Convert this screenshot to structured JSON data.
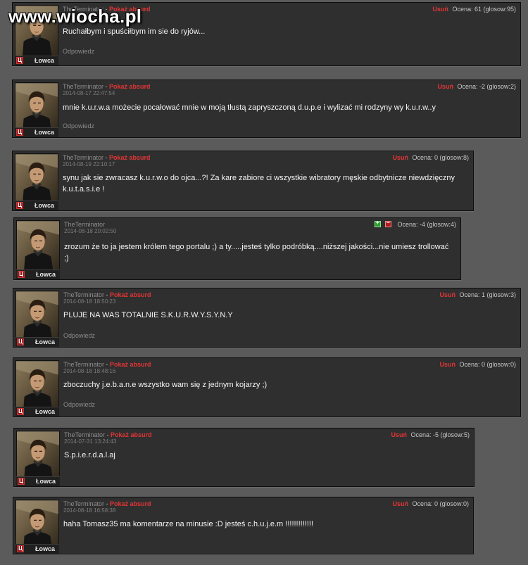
{
  "watermark": "www.wiocha.pl",
  "labels": {
    "separator": " - ",
    "absurd": "Pokaż absurd",
    "delete": "Usuń",
    "reply": "Odpowiedz",
    "rank": "Łowca",
    "rank_badge": "Ц"
  },
  "comments": [
    {
      "user": "TheTerminator",
      "date": "",
      "score": "Ocena: 61 (glosow:95)",
      "text": "Ruchałbym i spuściłbym im sie do ryjów..."
    },
    {
      "user": "TheTerminator",
      "date": "2014-08-17 22:47:54",
      "score": "Ocena: -2 (glosow:2)",
      "text": "mnie k.u.r.w.a możecie pocałować mnie w moją tłustą zapryszczoną d.u.p.e i wylizać mi rodzyny wy k.u.r.w..y"
    },
    {
      "user": "TheTerminator",
      "date": "2014-08-19 22:10:17",
      "score": "Ocena: 0 (glosow:8)",
      "text": "synu jak sie zwracasz k.u.r.w.o do ojca...?! Za kare zabiore ci wszystkie wibratory męskie odbytnicze niewdzięczny k.u.t.a.s.i.e !"
    },
    {
      "user": "TheTerminator",
      "date": "2014-08-18 20:02:50",
      "score": "Ocena: -4 (glosow:4)",
      "text": "zrozum że to ja jestem królem tego portalu ;) a ty.....jesteś tylko podróbką....niższej jakości...nie umiesz trollować ;)"
    },
    {
      "user": "TheTerminator",
      "date": "2014-08-18 18:50:23",
      "score": "Ocena: 1 (glosow:3)",
      "text": "PLUJE NA WAS TOTALNIE S.K.U.R.W.Y.S.Y.N.Y"
    },
    {
      "user": "TheTerminator",
      "date": "2014-08-18 18:48:16",
      "score": "Ocena: 0 (glosow:0)",
      "text": "zboczuchy j.e.b.a.n.e wszystko wam się z jednym kojarzy ;)"
    },
    {
      "user": "TheTerminator",
      "date": "2014-07-31 13:24:43",
      "score": "Ocena: -5 (glosow:5)",
      "text": "S.p.i.e.r.d.a.l.aj"
    },
    {
      "user": "TheTerminator",
      "date": "2014-08-18 16:58:38",
      "score": "Ocena: 0 (glosow:0)",
      "text": "haha Tomasz35 ma komentarze na minusie :D jesteś c.h.u.j.e.m !!!!!!!!!!!!!"
    }
  ]
}
